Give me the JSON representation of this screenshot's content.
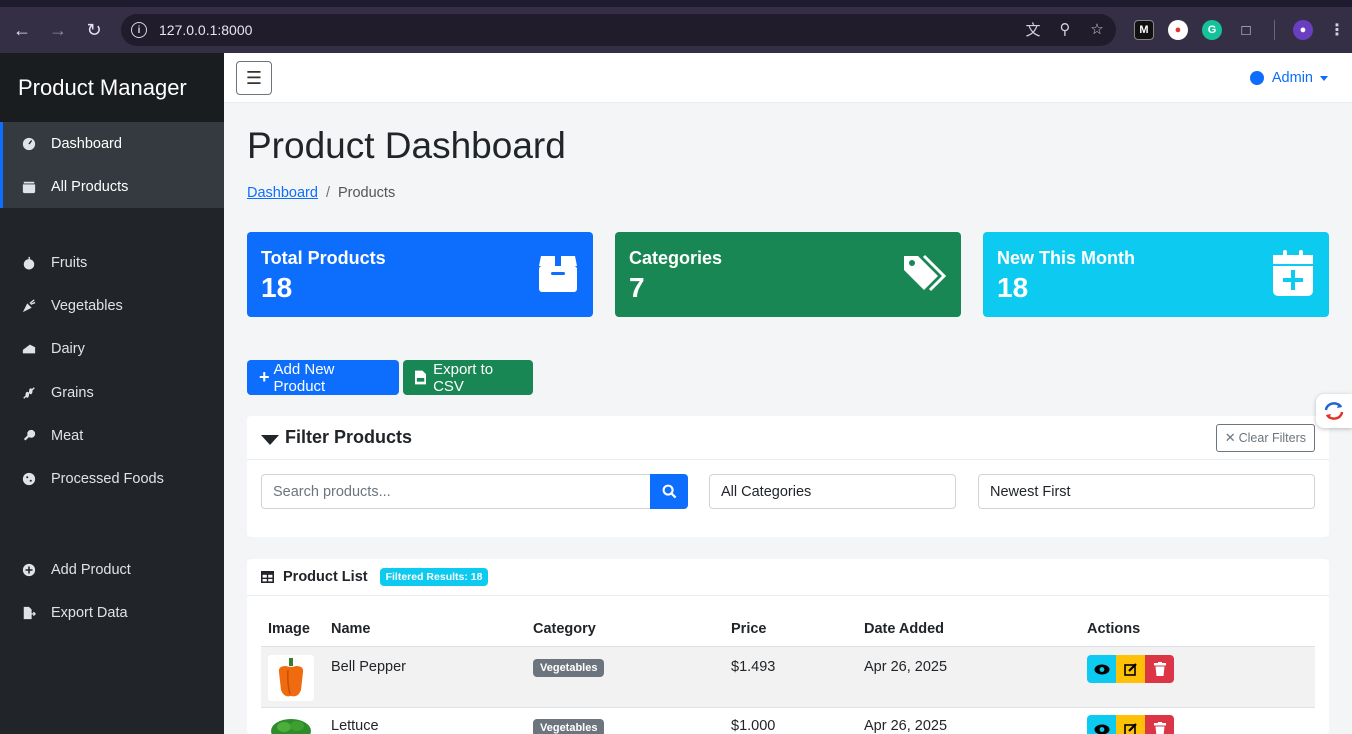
{
  "browser": {
    "url": "127.0.0.1:8000"
  },
  "sidebar": {
    "brand": "Product Manager",
    "items": [
      {
        "label": "Dashboard",
        "icon": "gauge-icon"
      },
      {
        "label": "All Products",
        "icon": "box-icon"
      },
      {
        "label": "Fruits",
        "icon": "apple-icon"
      },
      {
        "label": "Vegetables",
        "icon": "carrot-icon"
      },
      {
        "label": "Dairy",
        "icon": "cheese-icon"
      },
      {
        "label": "Grains",
        "icon": "wheat-icon"
      },
      {
        "label": "Meat",
        "icon": "drumstick-icon"
      },
      {
        "label": "Processed Foods",
        "icon": "cookie-icon"
      },
      {
        "label": "Add Product",
        "icon": "plus-circle-icon"
      },
      {
        "label": "Export Data",
        "icon": "file-export-icon"
      }
    ]
  },
  "topnav": {
    "user": "Admin"
  },
  "page": {
    "title": "Product Dashboard",
    "breadcrumb": [
      "Dashboard",
      "Products"
    ]
  },
  "stats": [
    {
      "label": "Total Products",
      "value": "18",
      "color": "#0d6efd",
      "icon": "box-icon"
    },
    {
      "label": "Categories",
      "value": "7",
      "color": "#198754",
      "icon": "tags-icon"
    },
    {
      "label": "New This Month",
      "value": "18",
      "color": "#0dcaf0",
      "icon": "calendar-plus-icon"
    }
  ],
  "actions": {
    "add": "Add New Product",
    "export": "Export to CSV"
  },
  "filter": {
    "title": "Filter Products",
    "clear": "Clear Filters",
    "search_placeholder": "Search products...",
    "category": "All Categories",
    "sort": "Newest First"
  },
  "list": {
    "title": "Product List",
    "badge": "Filtered Results: 18",
    "columns": [
      "Image",
      "Name",
      "Category",
      "Price",
      "Date Added",
      "Actions"
    ],
    "rows": [
      {
        "name": "Bell Pepper",
        "category": "Vegetables",
        "price": "$1.493",
        "date": "Apr 26, 2025"
      },
      {
        "name": "Lettuce",
        "category": "Vegetables",
        "price": "$1.000",
        "date": "Apr 26, 2025"
      }
    ]
  }
}
